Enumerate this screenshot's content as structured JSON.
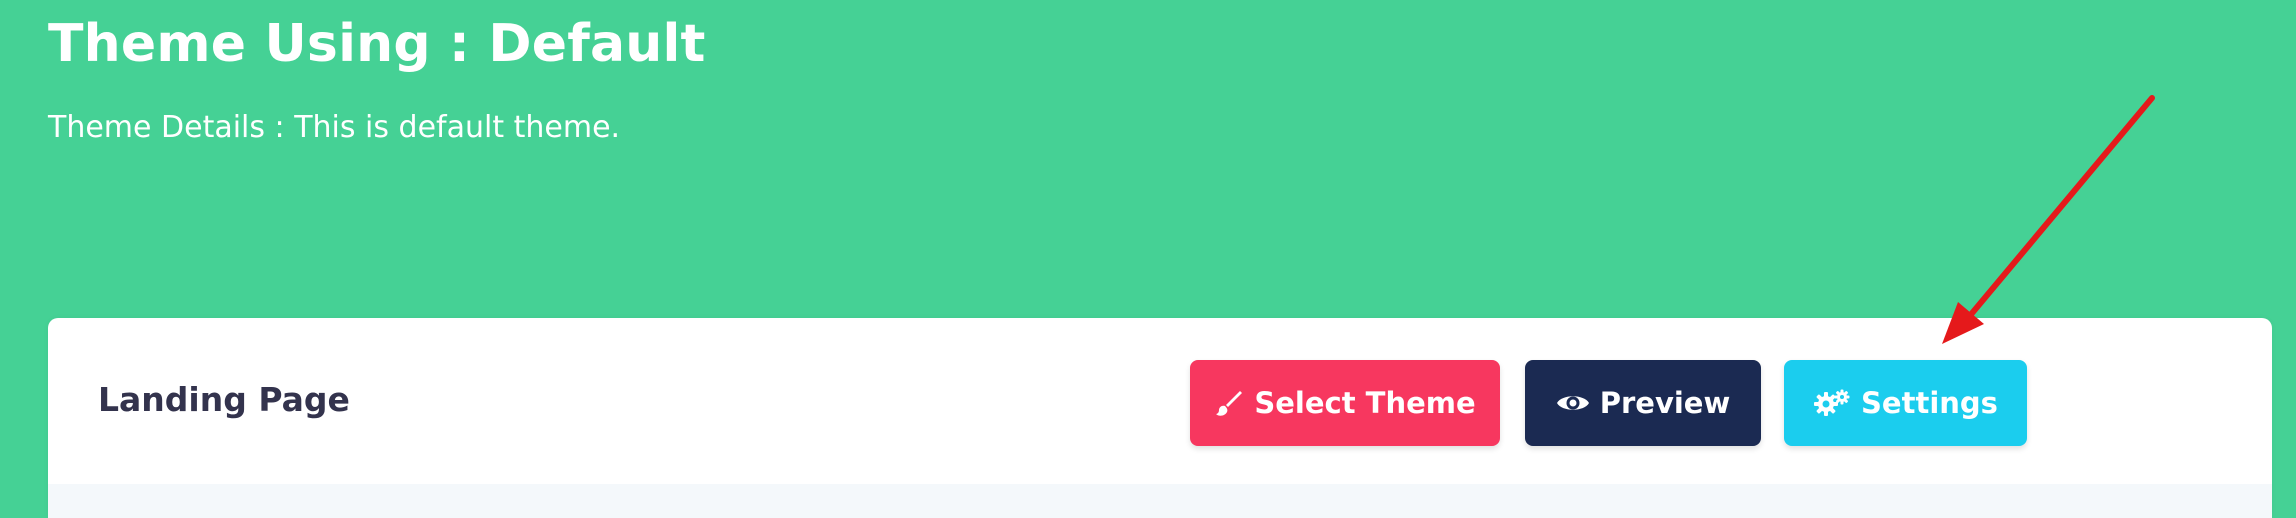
{
  "header": {
    "title": "Theme Using : Default",
    "details": "Theme Details : This is default theme."
  },
  "card": {
    "title": "Landing Page",
    "buttons": {
      "select_theme": "Select Theme",
      "preview": "Preview",
      "settings": "Settings"
    }
  },
  "icons": {
    "select_theme": "paintbrush-icon",
    "preview": "eye-icon",
    "settings": "gears-icon"
  },
  "colors": {
    "background": "#45d195",
    "select_theme": "#f7375f",
    "preview": "#1b2a52",
    "settings": "#1bcdee",
    "annotation_arrow": "#e5191b"
  }
}
